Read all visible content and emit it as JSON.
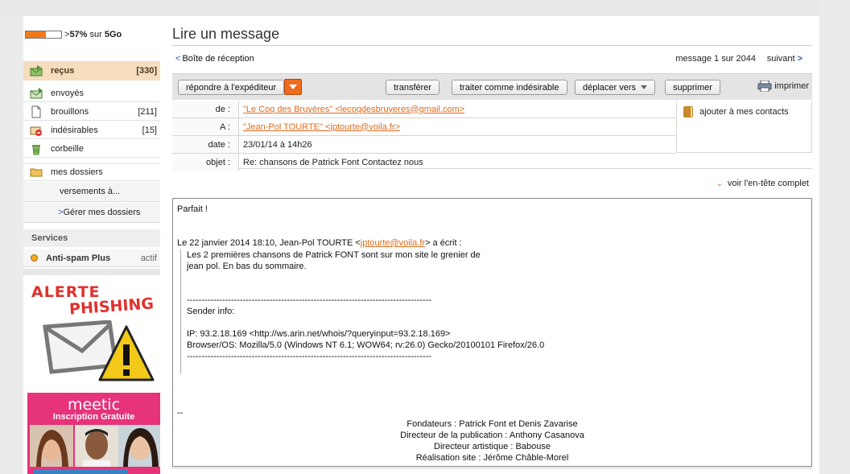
{
  "quota": {
    "percent": 57,
    "label_pre": ">",
    "label_pct": "57%",
    "label_mid": " sur ",
    "label_total": "5Go"
  },
  "folders": [
    {
      "label": "reçus",
      "count": "[330]"
    },
    {
      "label": "envoyés",
      "count": ""
    },
    {
      "label": "brouillons",
      "count": "[211]"
    },
    {
      "label": "indésirables",
      "count": "[15]"
    },
    {
      "label": "corbeille",
      "count": ""
    },
    {
      "label": "mes dossiers",
      "count": ""
    }
  ],
  "subfolders": {
    "item": "versements à...",
    "manage": "Gérer mes dossiers",
    "manage_chev": ">"
  },
  "services": {
    "heading": "Services",
    "antispam_label": "Anti-spam Plus",
    "antispam_status": "actif"
  },
  "ads": {
    "phishing_line1": "ALERTE",
    "phishing_line2": "PHISHING",
    "meetic_logo": "meetic",
    "meetic_sub": "Inscription Gratuite"
  },
  "header": {
    "title": "Lire un message",
    "back_chev": "<",
    "back_label": "Boîte de réception",
    "position": "message 1 sur 2044",
    "next_label": "suivant",
    "next_chev": ">"
  },
  "toolbar": {
    "reply": "répondre à l'expéditeur",
    "forward": "transférer",
    "spam": "traiter comme indésirable",
    "move": "déplacer vers",
    "delete": "supprimer",
    "print": "imprimer"
  },
  "message": {
    "from_label": "de :",
    "from_value": "\"Le Coq des Bruyères\" <lecoqdesbruyeres@gmail.com>",
    "to_label": "A :",
    "to_value": "\"Jean-Pol TOURTE\" <jptourte@voila.fr>",
    "date_label": "date :",
    "date_value": "23/01/14 à 14h26",
    "subject_label": "objet :",
    "subject_value": "Re: chansons de Patrick Font Contactez nous",
    "add_contacts": "ajouter à mes contacts",
    "full_header": "voir l'en-tête complet"
  },
  "body": {
    "greeting": "Parfait !",
    "reply_intro_pre": "Le 22 janvier 2014 18:10, Jean-Pol TOURTE <",
    "reply_intro_link": "jptourte@voila.fr",
    "reply_intro_post": "> a écrit :",
    "quote_line1": "Les 2 premières chansons de Patrick FONT sont sur mon site le grenier de",
    "quote_line2": "jean pol. En bas du sommaire.",
    "rule1": "-----------------------------------------------------------------------------------",
    "sender_info": "Sender info:",
    "ip_line": "IP: 93.2.18.169 <http://ws.arin.net/whois/?queryinput=93.2.18.169>",
    "browser_line": "Browser/OS: Mozilla/5.0 (Windows NT 6.1; WOW64; rv:26.0) Gecko/20100101 Firefox/26.0",
    "rule2": "-----------------------------------------------------------------------------------",
    "sig_sep": "--",
    "sig1": "Fondateurs : Patrick Font et Denis Zavarise",
    "sig2": "Directeur de la publication : Anthony Casanova",
    "sig3": "Directeur artistique : Babouse",
    "sig4": "Réalisation site : Jérôme Châble-Morel"
  },
  "colors": {
    "accent": "#f06a1b",
    "link": "#e06a1c",
    "active_folder_bg": "#f5ddbd"
  }
}
